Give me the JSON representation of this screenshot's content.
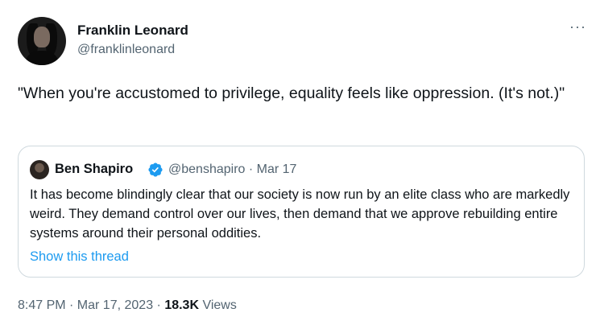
{
  "author": {
    "display_name": "Franklin Leonard",
    "handle": "@franklinleonard"
  },
  "more_label": "···",
  "tweet": {
    "text": "\"When you're accustomed to privilege, equality feels like oppression. (It's not.)\""
  },
  "quoted_tweet": {
    "display_name": "Ben Shapiro",
    "handle_and_date": "@benshapiro · Mar 17",
    "verified_icon": "verified-badge-icon",
    "text": "It has become blindingly clear that our society is now run by an elite class who are markedly weird. They demand control over our lives, then demand that we approve rebuilding entire systems around their personal oddities.",
    "thread_link": "Show this thread"
  },
  "meta": {
    "timestamp": "8:47 PM · Mar 17, 2023",
    "separator": " · ",
    "views_count": "18.3K",
    "views_label": " Views"
  },
  "colors": {
    "text": "#0f1419",
    "secondary": "#536471",
    "link": "#1d9bf0",
    "border": "#cfd9de"
  }
}
